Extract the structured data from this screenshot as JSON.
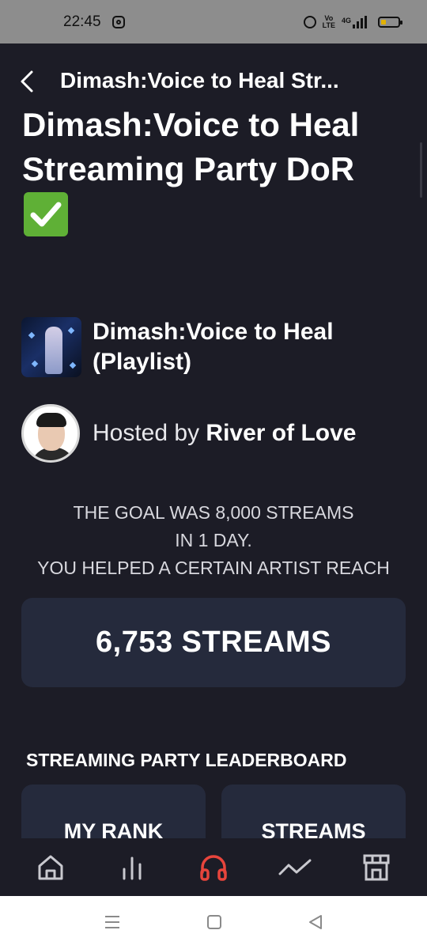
{
  "status_bar": {
    "time": "22:45",
    "network": "4G",
    "volte": "Vo LTE",
    "icons": [
      "instagram-icon",
      "alarm-icon",
      "volte-icon",
      "signal-icon",
      "battery-icon"
    ]
  },
  "header": {
    "title": "Dimash:Voice to Heal Str...",
    "back_icon": "chevron-left-icon"
  },
  "page": {
    "title": "Dimash:Voice to Heal Streaming Party DoR",
    "title_emoji": "check-mark-button-icon"
  },
  "playlist": {
    "name": "Dimash:Voice to Heal (Playlist)"
  },
  "host": {
    "prefix": "Hosted by ",
    "name": "River of Love"
  },
  "goal": {
    "line1": "THE GOAL WAS 8,000 STREAMS",
    "line2": "IN 1 DAY.",
    "line3": "YOU HELPED A CERTAIN ARTIST REACH"
  },
  "streams": {
    "value": "6,753 STREAMS"
  },
  "leaderboard": {
    "title": "STREAMING PARTY LEADERBOARD",
    "my_rank_label": "MY RANK",
    "streams_label": "STREAMS"
  },
  "tabs": [
    {
      "icon": "home-icon",
      "active": false
    },
    {
      "icon": "bar-chart-icon",
      "active": false
    },
    {
      "icon": "headphones-icon",
      "active": true
    },
    {
      "icon": "trending-icon",
      "active": false
    },
    {
      "icon": "store-icon",
      "active": false
    }
  ],
  "colors": {
    "background": "#1c1c26",
    "card": "#252a3c",
    "accent": "#e8453c",
    "inactive_icon": "#c9c9cf",
    "check_green": "#5fb036"
  },
  "nav_bar": {
    "icons": [
      "menu-icon",
      "home-square-icon",
      "back-triangle-icon"
    ]
  }
}
